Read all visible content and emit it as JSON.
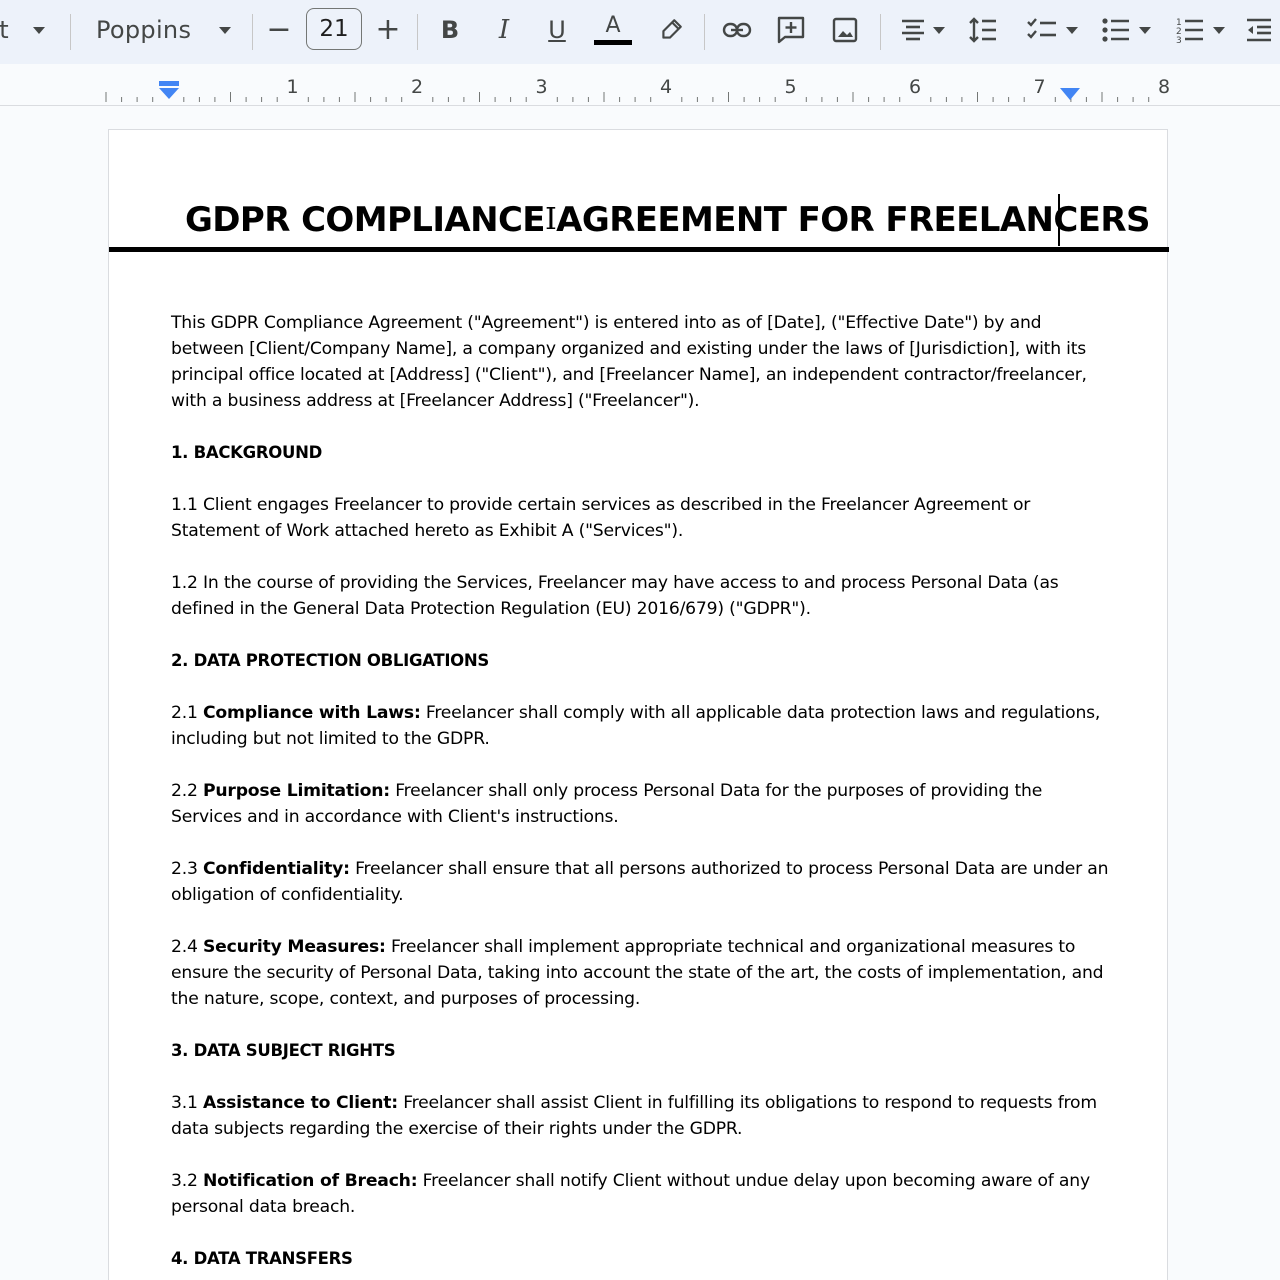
{
  "toolbar": {
    "font_name": "Poppins",
    "font_size": "21",
    "decrease_glyph": "−",
    "increase_glyph": "+",
    "bold_glyph": "B",
    "italic_glyph": "I",
    "underline_glyph": "U",
    "text_color_glyph": "A"
  },
  "ruler": {
    "numbers": [
      "1",
      "2",
      "3",
      "4",
      "5",
      "6",
      "7",
      "8"
    ]
  },
  "document": {
    "title": "GDPR COMPLIANCE AGREEMENT FOR FREELANCERS",
    "intro": "This GDPR Compliance Agreement (\"Agreement\") is entered into as of [Date], (\"Effective Date\") by and between [Client/Company Name], a company organized and existing under the laws of [Jurisdiction], with its principal office located at [Address] (\"Client\"), and [Freelancer Name], an independent contractor/freelancer, with a business address at [Freelancer Address] (\"Freelancer\").",
    "section1": {
      "heading": "1. BACKGROUND",
      "p1": "1.1 Client engages Freelancer to provide certain services as described in the Freelancer Agreement or Statement of Work attached hereto as Exhibit A (\"Services\").",
      "p2": "1.2 In the course of providing the Services, Freelancer may have access to and process Personal Data (as defined in the General Data Protection Regulation (EU) 2016/679) (\"GDPR\")."
    },
    "section2": {
      "heading": "2. DATA PROTECTION OBLIGATIONS",
      "p1_num": "2.1 ",
      "p1_lead": "Compliance with Laws:",
      "p1_text": " Freelancer shall comply with all applicable data protection laws and regulations, including but not limited to the GDPR.",
      "p2_num": "2.2 ",
      "p2_lead": "Purpose Limitation:",
      "p2_text": " Freelancer shall only process Personal Data for the purposes of providing the Services and in accordance with Client's instructions.",
      "p3_num": "2.3 ",
      "p3_lead": "Confidentiality:",
      "p3_text": " Freelancer shall ensure that all persons authorized to process Personal Data are under an obligation of confidentiality.",
      "p4_num": "2.4 ",
      "p4_lead": "Security Measures:",
      "p4_text": " Freelancer shall implement appropriate technical and organizational measures to ensure the security of Personal Data, taking into account the state of the art, the costs of implementation, and the nature, scope, context, and purposes of processing."
    },
    "section3": {
      "heading": "3. DATA SUBJECT RIGHTS",
      "p1_num": "3.1 ",
      "p1_lead": "Assistance to Client:",
      "p1_text": " Freelancer shall assist Client in fulfilling its obligations to respond to requests from data subjects regarding the exercise of their rights under the GDPR.",
      "p2_num": "3.2 ",
      "p2_lead": "Notification of Breach:",
      "p2_text": " Freelancer shall notify Client without undue delay upon becoming aware of any personal data breach."
    },
    "section4": {
      "heading": "4. DATA TRANSFERS"
    }
  },
  "colors": {
    "toolbar_bg": "#edf2fa",
    "icon": "#444746",
    "ruler_marker": "#4285f4",
    "text_color_underline": "#000000"
  }
}
